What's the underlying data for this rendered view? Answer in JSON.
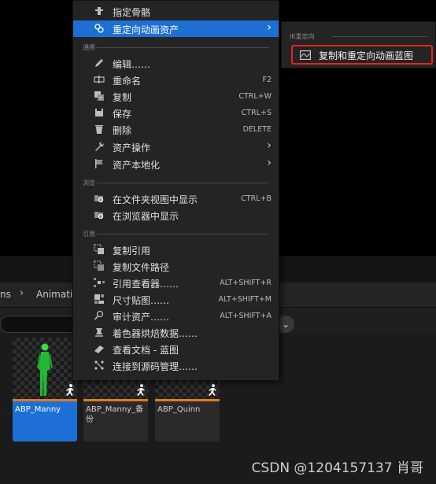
{
  "breadcrumb": {
    "partial": "ns",
    "current": "Animatio"
  },
  "search": {
    "dropdown": "⌄"
  },
  "assets": [
    {
      "name": "ABP_Manny",
      "selected": true
    },
    {
      "name": "ABP_Manny_备份",
      "selected": false
    },
    {
      "name": "ABP_Quinn",
      "selected": false
    }
  ],
  "menu": {
    "assign_skeleton": "指定骨骼",
    "retarget": "重定向动画资产",
    "section_general": "通用",
    "edit": "编辑……",
    "rename": {
      "label": "重命名",
      "shortcut": "F2"
    },
    "duplicate": {
      "label": "复制",
      "shortcut": "CTRL+W"
    },
    "save": {
      "label": "保存",
      "shortcut": "CTRL+S"
    },
    "delete": {
      "label": "删除",
      "shortcut": "DELETE"
    },
    "asset_actions": "资产操作",
    "asset_localization": "资产本地化",
    "section_browse": "浏览",
    "show_in_explorer": {
      "label": "在文件夹视图中显示",
      "shortcut": "CTRL+B"
    },
    "show_in_browser": "在浏览器中显示",
    "section_references": "引用",
    "copy_reference": "复制引用",
    "copy_file_path": "复制文件路径",
    "reference_viewer": {
      "label": "引用查看器……",
      "shortcut": "ALT+SHIFT+R"
    },
    "size_map": {
      "label": "尺寸贴图……",
      "shortcut": "ALT+SHIFT+M"
    },
    "audit_assets": {
      "label": "审计资产……",
      "shortcut": "ALT+SHIFT+A"
    },
    "shader_cook": "着色器烘焙数据……",
    "view_docs": "查看文档 - 蓝图",
    "source_control": "连接到源码管理……"
  },
  "submenu": {
    "section": "IK重定向",
    "duplicate_retarget": "复制和重定向动画蓝图"
  },
  "watermark": "CSDN @1204157137 肖哥",
  "colors": {
    "highlight": "#1d6fd4",
    "selected_tile": "#1b6fd6",
    "anim_bar": "#e07b1a",
    "callout": "#e8241b"
  }
}
